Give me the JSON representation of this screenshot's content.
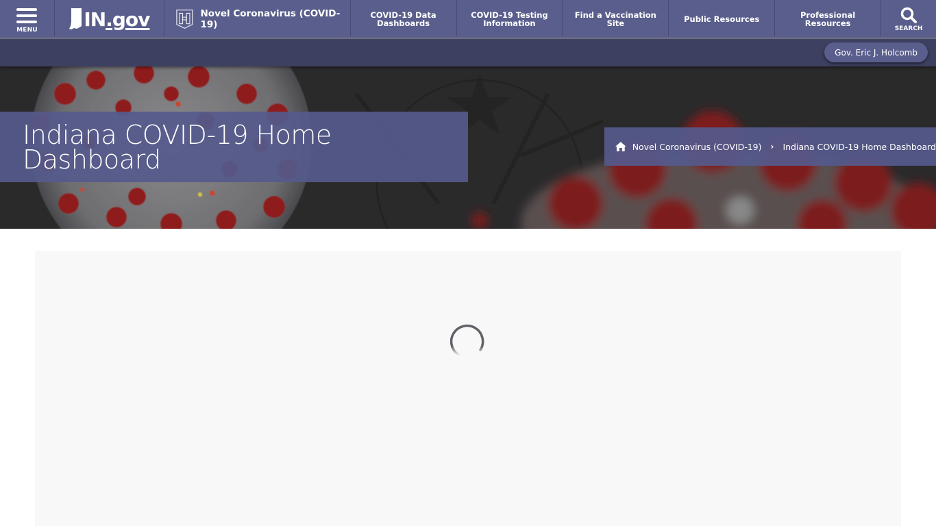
{
  "nav": {
    "menu_label": "MENU",
    "logo_text_in": "IN",
    "logo_text_gov": ".gov",
    "agency_label": "Novel Coronavirus (COVID-19)",
    "links": [
      {
        "label": "COVID-19 Data Dashboards"
      },
      {
        "label": "COVID-19 Testing Information"
      },
      {
        "label": "Find a Vaccination Site"
      },
      {
        "label": "Public Resources"
      },
      {
        "label": "Professional Resources"
      }
    ],
    "search_label": "SEARCH"
  },
  "subbar": {
    "governor_button": "Gov. Eric J. Holcomb"
  },
  "hero": {
    "page_title": "Indiana COVID-19 Home Dashboard",
    "breadcrumb": {
      "parent": "Novel Coronavirus (COVID-19)",
      "separator": "›",
      "current": "Indiana COVID-19 Home Dashboard"
    }
  },
  "content": {
    "state": "loading"
  },
  "colors": {
    "nav_bg": "#5a5e8c",
    "subbar_bg": "#3d4060",
    "panel_overlay": "#555a8c",
    "content_bg": "#f8f8f8",
    "spinner": "#5f6368"
  }
}
